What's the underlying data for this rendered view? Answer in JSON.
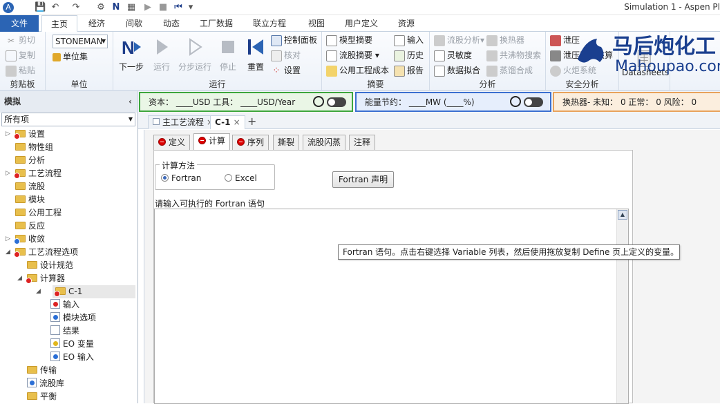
{
  "titlebar": {
    "title": "Simulation 1 - Aspen Pl"
  },
  "ribbon_tabs": [
    "文件",
    "主页",
    "经济",
    "间歇",
    "动态",
    "工厂数据",
    "联立方程",
    "视图",
    "用户定义",
    "资源"
  ],
  "clipboard": {
    "cut": "剪切",
    "copy": "复制",
    "paste": "粘贴",
    "label": "剪贴板"
  },
  "units": {
    "unitset_value": "STONEMAN",
    "unitsets": "单位集",
    "label": "单位"
  },
  "run": {
    "next": "下一步",
    "run": "运行",
    "step": "分步运行",
    "stop": "停止",
    "reset": "重置",
    "control_panel": "控制面板",
    "check": "核对",
    "settings": "设置",
    "label": "运行"
  },
  "summary": {
    "model_summary": "模型摘要",
    "stream_summary": "流股摘要",
    "utility_costs": "公用工程成本",
    "input": "输入",
    "history": "历史",
    "report": "报告",
    "label": "摘要"
  },
  "analysis": {
    "stream_analysis": "流股分析",
    "heat_exchanger": "换热器",
    "sensitivity": "灵敏度",
    "azeotrope_search": "共沸物搜索",
    "data_fit": "数据拟合",
    "distillation_synthesis": "蒸馏合成",
    "label": "分析"
  },
  "safety": {
    "pressure_relief": "泄压",
    "relief_check": "泄压装置核算",
    "flare_system": "火炬系统",
    "label": "安全分析"
  },
  "datasheets": {
    "label": "Datasheets"
  },
  "logo": {
    "cn": "马后炮化工",
    "en": "Mahoupao.com"
  },
  "status": {
    "nav_title": "模拟",
    "capital": "资本： ____USD   工具： ____USD/Year",
    "energy": "能量节约： ____MW    (____%)",
    "hx": "换热器- 未知： 0   正常： 0   风险： 0"
  },
  "nav": {
    "filter": "所有项",
    "items": [
      "设置",
      "物性组",
      "分析",
      "工艺流程",
      "流股",
      "模块",
      "公用工程",
      "反应",
      "收敛",
      "工艺流程选项",
      "设计规范",
      "计算器",
      "C-1",
      "输入",
      "模块选项",
      "结果",
      "EO 变量",
      "EO 输入",
      "传输",
      "流股库",
      "平衡"
    ]
  },
  "doc_tabs": [
    "主工艺流程",
    "C-1"
  ],
  "form_tabs": [
    "定义",
    "计算",
    "序列",
    "撕裂",
    "流股闪蒸",
    "注释"
  ],
  "form": {
    "calc_method": "计算方法",
    "fortran": "Fortran",
    "excel": "Excel",
    "fortran_decl_button": "Fortran 声明",
    "prompt": "请输入可执行的 Fortran 语句",
    "tooltip": "Fortran 语句。点击右键选择 Variable 列表，然后使用拖放复制 Define 页上定义的变量。"
  }
}
